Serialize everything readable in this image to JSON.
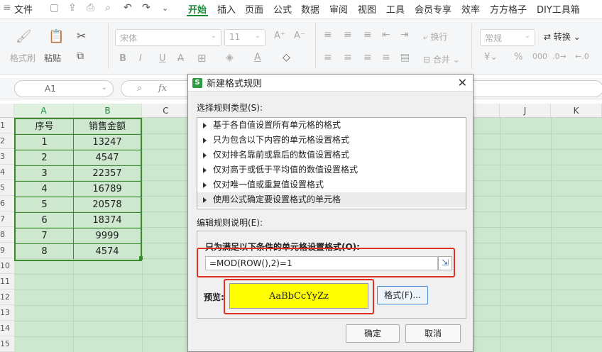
{
  "menubar": {
    "file": "文件",
    "tabs": [
      "开始",
      "插入",
      "页面",
      "公式",
      "数据",
      "审阅",
      "视图",
      "工具",
      "会员专享",
      "效率",
      "方方格子",
      "DIY工具箱"
    ],
    "active_tab": "开始"
  },
  "ribbon": {
    "format_painter": "格式刷",
    "paste": "粘贴",
    "font_name": "宋体",
    "font_size": "11",
    "wrap_text": "换行",
    "merge": "合并",
    "number_format": "常规",
    "convert": "转换"
  },
  "formula_bar": {
    "name_box": "A1",
    "fx_label": "fx"
  },
  "sheet": {
    "columns": [
      "A",
      "B",
      "C",
      "J",
      "K"
    ],
    "rows": [
      "1",
      "2",
      "3",
      "4",
      "5",
      "6",
      "7",
      "8",
      "9",
      "10",
      "11",
      "12",
      "13",
      "14",
      "15"
    ],
    "table_header": [
      "序号",
      "销售金额"
    ],
    "table_rows": [
      [
        "1",
        "13247"
      ],
      [
        "2",
        "4547"
      ],
      [
        "3",
        "22357"
      ],
      [
        "4",
        "16789"
      ],
      [
        "5",
        "20578"
      ],
      [
        "6",
        "18374"
      ],
      [
        "7",
        "9999"
      ],
      [
        "8",
        "4574"
      ]
    ]
  },
  "dialog": {
    "title": "新建格式规则",
    "select_rule_type": "选择规则类型(S):",
    "rule_types": [
      "基于各自值设置所有单元格的格式",
      "只为包含以下内容的单元格设置格式",
      "仅对排名靠前或靠后的数值设置格式",
      "仅对高于或低于平均值的数值设置格式",
      "仅对唯一值或重复值设置格式",
      "使用公式确定要设置格式的单元格"
    ],
    "edit_rule_desc": "编辑规则说明(E):",
    "formula_label": "只为满足以下条件的单元格设置格式(O):",
    "formula_value": "=MOD(ROW(),2)=1",
    "preview_label": "预览:",
    "preview_text": "AaBbCcYyZz",
    "preview_color": "#ffff00",
    "format_button": "格式(F)...",
    "ok_button": "确定",
    "cancel_button": "取消"
  },
  "colors": {
    "accent": "#1a8a3a",
    "band_green": "#cde8cf",
    "highlight_red": "#e03020"
  }
}
